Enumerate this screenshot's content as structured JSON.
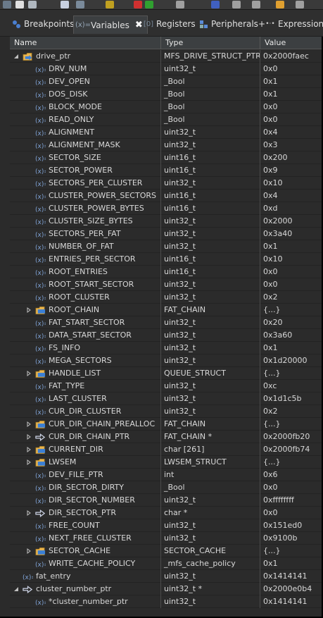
{
  "tabs": [
    {
      "label": "Breakpoints",
      "icon": "breakpoints-icon",
      "active": false
    },
    {
      "label": "Variables",
      "icon": "variables-icon",
      "active": true
    },
    {
      "label": "Registers",
      "icon": "registers-icon",
      "active": false
    },
    {
      "label": "Peripherals+",
      "icon": "peripherals-icon",
      "active": false
    },
    {
      "label": "Expressions",
      "icon": "expressions-icon",
      "active": false
    }
  ],
  "close_glyph": "✖",
  "columns": {
    "name": "Name",
    "type": "Type",
    "value": "Value"
  },
  "rows": [
    {
      "name": "drive_ptr",
      "type": "MFS_DRIVE_STRUCT_PTR",
      "value": "0x2000faec",
      "level": 0,
      "twisty": "expanded",
      "icon": "pointer-struct-icon"
    },
    {
      "name": "DRV_NUM",
      "type": "uint32_t",
      "value": "0x0",
      "level": 1,
      "twisty": "none",
      "icon": "field-icon"
    },
    {
      "name": "DEV_OPEN",
      "type": "_Bool",
      "value": "0x1",
      "level": 1,
      "twisty": "none",
      "icon": "field-icon"
    },
    {
      "name": "DOS_DISK",
      "type": "_Bool",
      "value": "0x1",
      "level": 1,
      "twisty": "none",
      "icon": "field-icon"
    },
    {
      "name": "BLOCK_MODE",
      "type": "_Bool",
      "value": "0x0",
      "level": 1,
      "twisty": "none",
      "icon": "field-icon"
    },
    {
      "name": "READ_ONLY",
      "type": "_Bool",
      "value": "0x0",
      "level": 1,
      "twisty": "none",
      "icon": "field-icon"
    },
    {
      "name": "ALIGNMENT",
      "type": "uint32_t",
      "value": "0x4",
      "level": 1,
      "twisty": "none",
      "icon": "field-icon"
    },
    {
      "name": "ALIGNMENT_MASK",
      "type": "uint32_t",
      "value": "0x3",
      "level": 1,
      "twisty": "none",
      "icon": "field-icon"
    },
    {
      "name": "SECTOR_SIZE",
      "type": "uint16_t",
      "value": "0x200",
      "level": 1,
      "twisty": "none",
      "icon": "field-icon"
    },
    {
      "name": "SECTOR_POWER",
      "type": "uint16_t",
      "value": "0x9",
      "level": 1,
      "twisty": "none",
      "icon": "field-icon"
    },
    {
      "name": "SECTORS_PER_CLUSTER",
      "type": "uint32_t",
      "value": "0x10",
      "level": 1,
      "twisty": "none",
      "icon": "field-icon"
    },
    {
      "name": "CLUSTER_POWER_SECTORS",
      "type": "uint16_t",
      "value": "0x4",
      "level": 1,
      "twisty": "none",
      "icon": "field-icon"
    },
    {
      "name": "CLUSTER_POWER_BYTES",
      "type": "uint16_t",
      "value": "0xd",
      "level": 1,
      "twisty": "none",
      "icon": "field-icon"
    },
    {
      "name": "CLUSTER_SIZE_BYTES",
      "type": "uint32_t",
      "value": "0x2000",
      "level": 1,
      "twisty": "none",
      "icon": "field-icon"
    },
    {
      "name": "SECTORS_PER_FAT",
      "type": "uint32_t",
      "value": "0x3a40",
      "level": 1,
      "twisty": "none",
      "icon": "field-icon"
    },
    {
      "name": "NUMBER_OF_FAT",
      "type": "uint32_t",
      "value": "0x1",
      "level": 1,
      "twisty": "none",
      "icon": "field-icon"
    },
    {
      "name": "ENTRIES_PER_SECTOR",
      "type": "uint16_t",
      "value": "0x10",
      "level": 1,
      "twisty": "none",
      "icon": "field-icon"
    },
    {
      "name": "ROOT_ENTRIES",
      "type": "uint16_t",
      "value": "0x0",
      "level": 1,
      "twisty": "none",
      "icon": "field-icon"
    },
    {
      "name": "ROOT_START_SECTOR",
      "type": "uint32_t",
      "value": "0x0",
      "level": 1,
      "twisty": "none",
      "icon": "field-icon"
    },
    {
      "name": "ROOT_CLUSTER",
      "type": "uint32_t",
      "value": "0x2",
      "level": 1,
      "twisty": "none",
      "icon": "field-icon"
    },
    {
      "name": "ROOT_CHAIN",
      "type": "FAT_CHAIN",
      "value": "{...}",
      "level": 1,
      "twisty": "collapsed",
      "icon": "struct-icon"
    },
    {
      "name": "FAT_START_SECTOR",
      "type": "uint32_t",
      "value": "0x20",
      "level": 1,
      "twisty": "none",
      "icon": "field-icon"
    },
    {
      "name": "DATA_START_SECTOR",
      "type": "uint32_t",
      "value": "0x3a60",
      "level": 1,
      "twisty": "none",
      "icon": "field-icon"
    },
    {
      "name": "FS_INFO",
      "type": "uint32_t",
      "value": "0x1",
      "level": 1,
      "twisty": "none",
      "icon": "field-icon"
    },
    {
      "name": "MEGA_SECTORS",
      "type": "uint32_t",
      "value": "0x1d20000",
      "level": 1,
      "twisty": "none",
      "icon": "field-icon"
    },
    {
      "name": "HANDLE_LIST",
      "type": "QUEUE_STRUCT",
      "value": "{...}",
      "level": 1,
      "twisty": "collapsed",
      "icon": "struct-icon"
    },
    {
      "name": "FAT_TYPE",
      "type": "uint32_t",
      "value": "0xc",
      "level": 1,
      "twisty": "none",
      "icon": "field-icon"
    },
    {
      "name": "LAST_CLUSTER",
      "type": "uint32_t",
      "value": "0x1d1c5b",
      "level": 1,
      "twisty": "none",
      "icon": "field-icon"
    },
    {
      "name": "CUR_DIR_CLUSTER",
      "type": "uint32_t",
      "value": "0x2",
      "level": 1,
      "twisty": "none",
      "icon": "field-icon"
    },
    {
      "name": "CUR_DIR_CHAIN_PREALLOC",
      "type": "FAT_CHAIN",
      "value": "{...}",
      "level": 1,
      "twisty": "collapsed",
      "icon": "struct-icon"
    },
    {
      "name": "CUR_DIR_CHAIN_PTR",
      "type": "FAT_CHAIN *",
      "value": "0x2000fb20",
      "level": 1,
      "twisty": "collapsed",
      "icon": "pointer-icon"
    },
    {
      "name": "CURRENT_DIR",
      "type": "char [261]",
      "value": "0x2000fb74",
      "level": 1,
      "twisty": "collapsed",
      "icon": "struct-icon"
    },
    {
      "name": "LWSEM",
      "type": "LWSEM_STRUCT",
      "value": "{...}",
      "level": 1,
      "twisty": "collapsed",
      "icon": "struct-icon"
    },
    {
      "name": "DEV_FILE_PTR",
      "type": "int",
      "value": "0x6",
      "level": 1,
      "twisty": "none",
      "icon": "field-icon"
    },
    {
      "name": "DIR_SECTOR_DIRTY",
      "type": "_Bool",
      "value": "0x0",
      "level": 1,
      "twisty": "none",
      "icon": "field-icon"
    },
    {
      "name": "DIR_SECTOR_NUMBER",
      "type": "uint32_t",
      "value": "0xffffffff",
      "level": 1,
      "twisty": "none",
      "icon": "field-icon"
    },
    {
      "name": "DIR_SECTOR_PTR",
      "type": "char *",
      "value": "0x0",
      "level": 1,
      "twisty": "collapsed",
      "icon": "pointer-icon"
    },
    {
      "name": "FREE_COUNT",
      "type": "uint32_t",
      "value": "0x151ed0",
      "level": 1,
      "twisty": "none",
      "icon": "field-icon"
    },
    {
      "name": "NEXT_FREE_CLUSTER",
      "type": "uint32_t",
      "value": "0x9100b",
      "level": 1,
      "twisty": "none",
      "icon": "field-icon"
    },
    {
      "name": "SECTOR_CACHE",
      "type": "SECTOR_CACHE",
      "value": "{...}",
      "level": 1,
      "twisty": "collapsed",
      "icon": "struct-icon"
    },
    {
      "name": "WRITE_CACHE_POLICY",
      "type": "_mfs_cache_policy",
      "value": "0x1",
      "level": 1,
      "twisty": "none",
      "icon": "field-icon"
    },
    {
      "name": "fat_entry",
      "type": "uint32_t",
      "value": "0x1414141",
      "level": 0,
      "twisty": "none",
      "icon": "field-icon"
    },
    {
      "name": "cluster_number_ptr",
      "type": "uint32_t *",
      "value": "0x2000e0b4",
      "level": 0,
      "twisty": "expanded",
      "icon": "pointer-icon"
    },
    {
      "name": "*cluster_number_ptr",
      "type": "uint32_t",
      "value": "0x1414141",
      "level": 1,
      "twisty": "none",
      "icon": "field-icon"
    }
  ]
}
